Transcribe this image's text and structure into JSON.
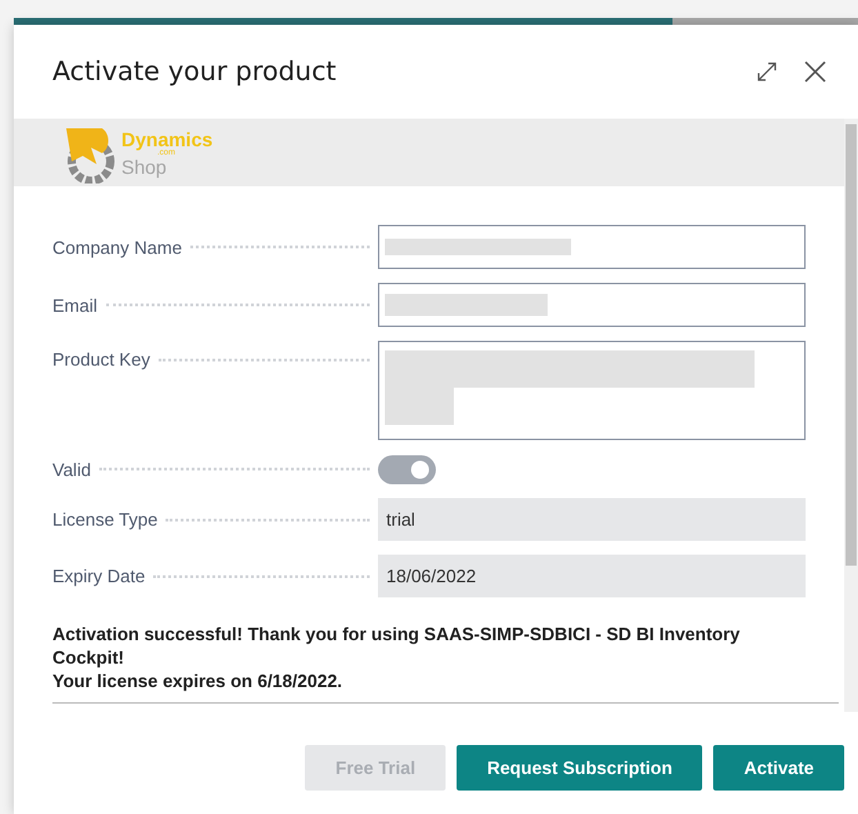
{
  "dialog": {
    "title": "Activate your product"
  },
  "logo": {
    "word_1": "Dynamics",
    "word_2": ".com",
    "word_3": "Shop"
  },
  "fields": [
    {
      "kind": "text",
      "label": "Company Name",
      "redacted": true
    },
    {
      "kind": "text",
      "label": "Email",
      "redacted": true
    },
    {
      "kind": "multiline",
      "label": "Product Key",
      "redacted": true
    },
    {
      "kind": "toggle",
      "label": "Valid",
      "on": true,
      "disabled": true
    },
    {
      "kind": "readonly",
      "label": "License Type",
      "value": "trial"
    },
    {
      "kind": "readonly",
      "label": "Expiry Date",
      "value": "18/06/2022"
    }
  ],
  "message": [
    "Activation successful! Thank you for using SAAS-SIMP-SDBICI - SD BI Inventory Cockpit!",
    "Your license expires on 6/18/2022."
  ],
  "buttons": [
    {
      "label": "Free Trial",
      "disabled": true
    },
    {
      "label": "Request Subscription",
      "disabled": false
    },
    {
      "label": "Activate",
      "disabled": false
    }
  ]
}
